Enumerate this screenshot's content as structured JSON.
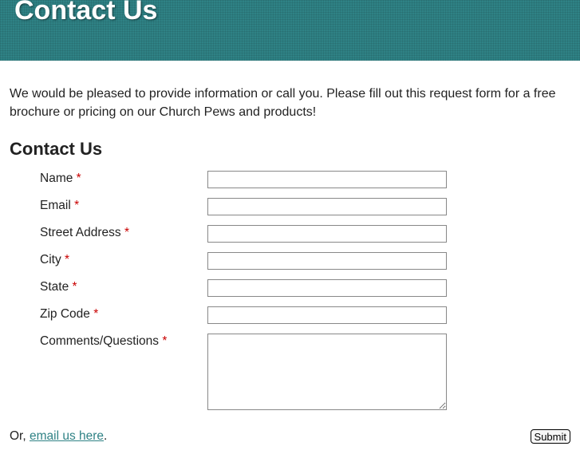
{
  "banner": {
    "title": "Contact Us"
  },
  "intro": "We would be pleased to provide information or call you. Please fill out this request form for a free brochure or pricing on our Church Pews and products!",
  "form": {
    "heading": "Contact Us",
    "required_mark": "*",
    "fields": {
      "name": "Name",
      "email": "Email",
      "street": "Street Address",
      "city": "City",
      "state": "State",
      "zip": "Zip Code",
      "comments": "Comments/Questions"
    }
  },
  "footer": {
    "or_prefix": "Or, ",
    "email_link": "email us here",
    "or_suffix": ".",
    "submit": "Submit"
  }
}
